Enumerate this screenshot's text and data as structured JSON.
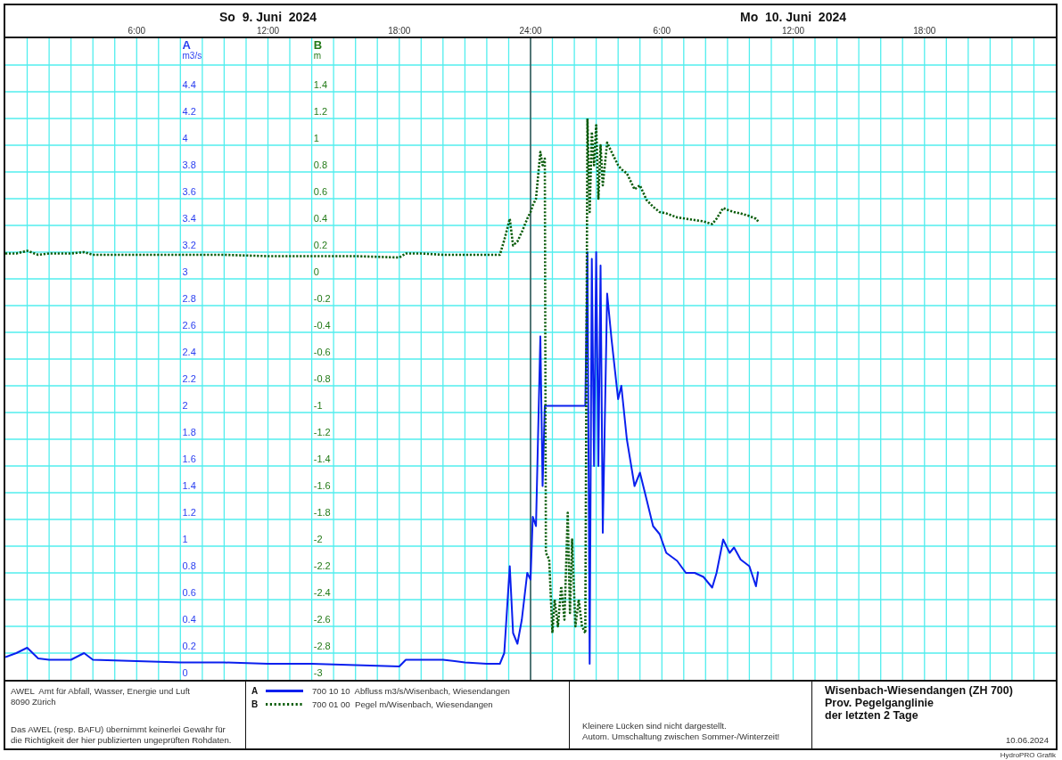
{
  "days": [
    "So  9. Juni  2024",
    "Mo  10. Juni  2024"
  ],
  "charts": [
    {
      "color": "#2a3ff0",
      "chart_data": {
        "type": "line",
        "ylabel": "m3/s",
        "grid": true,
        "xlim": [
          "2024-06-09T00:00",
          "2024-06-11T00:00"
        ],
        "ylim": [
          0,
          4.8
        ],
        "xticks": [
          {
            "value": "2024-06-09T06:00",
            "label": "6:00"
          },
          {
            "value": "2024-06-09T12:00",
            "label": "12:00"
          },
          {
            "value": "2024-06-09T18:00",
            "label": "18:00"
          },
          {
            "value": "2024-06-09T24:00",
            "label": "24:00"
          },
          {
            "value": "2024-06-10T06:00",
            "label": "6:00"
          },
          {
            "value": "2024-06-10T12:00",
            "label": "12:00"
          },
          {
            "value": "2024-06-10T18:00",
            "label": "18:00"
          }
        ],
        "yticks": [
          {
            "value": 0,
            "label": "0"
          },
          {
            "value": 0.2,
            "label": "0.2"
          },
          {
            "value": 0.4,
            "label": "0.4"
          },
          {
            "value": 0.6,
            "label": "0.6"
          },
          {
            "value": 0.8,
            "label": "0.8"
          },
          {
            "value": 1,
            "label": "1"
          },
          {
            "value": 1.2,
            "label": "1.2"
          },
          {
            "value": 1.4,
            "label": "1.4"
          },
          {
            "value": 1.6,
            "label": "1.6"
          },
          {
            "value": 1.8,
            "label": "1.8"
          },
          {
            "value": 2,
            "label": "2"
          },
          {
            "value": 2.2,
            "label": "2.2"
          },
          {
            "value": 2.4,
            "label": "2.4"
          },
          {
            "value": 2.6,
            "label": "2.6"
          },
          {
            "value": 2.8,
            "label": "2.8"
          },
          {
            "value": 3,
            "label": "3"
          },
          {
            "value": 3.2,
            "label": "3.2"
          },
          {
            "value": 3.4,
            "label": "3.4"
          },
          {
            "value": 3.6,
            "label": "3.6"
          },
          {
            "value": 3.8,
            "label": "3.8"
          },
          {
            "value": 4,
            "label": "4"
          },
          {
            "value": 4.2,
            "label": "4.2"
          },
          {
            "value": 4.4,
            "label": "4.4"
          }
        ],
        "ref_lines": [
          {
            "axis": "x",
            "value": "2024-06-09T24:00"
          }
        ],
        "x": [
          "2024-06-09T00:00",
          "2024-06-09T00:30",
          "2024-06-09T01:00",
          "2024-06-09T01:30",
          "2024-06-09T02:00",
          "2024-06-09T03:00",
          "2024-06-09T03:36",
          "2024-06-09T04:00",
          "2024-06-09T06:00",
          "2024-06-09T08:00",
          "2024-06-09T10:00",
          "2024-06-09T12:00",
          "2024-06-09T14:00",
          "2024-06-09T16:00",
          "2024-06-09T18:00",
          "2024-06-09T18:18",
          "2024-06-09T19:00",
          "2024-06-09T20:00",
          "2024-06-09T21:00",
          "2024-06-09T22:00",
          "2024-06-09T22:36",
          "2024-06-09T22:48",
          "2024-06-09T23:03",
          "2024-06-09T23:12",
          "2024-06-09T23:24",
          "2024-06-09T23:36",
          "2024-06-09T23:51",
          "2024-06-10T00:00",
          "2024-06-10T00:06",
          "2024-06-10T00:15",
          "2024-06-10T00:27",
          "2024-06-10T00:33",
          "2024-06-10T00:39",
          "2024-06-10T00:42",
          "2024-06-10T00:51",
          "2024-06-10T01:00",
          "2024-06-10T01:06",
          "2024-06-10T01:15",
          "2024-06-10T01:24",
          "2024-06-10T01:33",
          "2024-06-10T01:42",
          "2024-06-10T01:48",
          "2024-06-10T01:54",
          "2024-06-10T02:03",
          "2024-06-10T02:12",
          "2024-06-10T02:21",
          "2024-06-10T02:30",
          "2024-06-10T02:36",
          "2024-06-10T02:42",
          "2024-06-10T02:48",
          "2024-06-10T02:54",
          "2024-06-10T03:00",
          "2024-06-10T03:06",
          "2024-06-10T03:12",
          "2024-06-10T03:18",
          "2024-06-10T03:30",
          "2024-06-10T03:42",
          "2024-06-10T04:00",
          "2024-06-10T04:09",
          "2024-06-10T04:24",
          "2024-06-10T04:45",
          "2024-06-10T05:00",
          "2024-06-10T05:18",
          "2024-06-10T05:36",
          "2024-06-10T05:54",
          "2024-06-10T06:12",
          "2024-06-10T06:42",
          "2024-06-10T07:06",
          "2024-06-10T07:30",
          "2024-06-10T07:54",
          "2024-06-10T08:18",
          "2024-06-10T08:30",
          "2024-06-10T08:48",
          "2024-06-10T09:06",
          "2024-06-10T09:18",
          "2024-06-10T09:36",
          "2024-06-10T10:00",
          "2024-06-10T10:18",
          "2024-06-10T10:24"
        ],
        "series": [
          {
            "name": "A",
            "color": "#0a20ee",
            "line_style": "solid",
            "values": [
              0.17,
              0.2,
              0.24,
              0.16,
              0.15,
              0.15,
              0.2,
              0.15,
              0.14,
              0.13,
              0.13,
              0.12,
              0.12,
              0.11,
              0.1,
              0.15,
              0.15,
              0.15,
              0.13,
              0.12,
              0.12,
              0.2,
              0.85,
              0.35,
              0.27,
              0.45,
              0.8,
              0.75,
              1.22,
              1.15,
              2.57,
              1.45,
              2.05,
              2.05,
              2.05,
              2.05,
              2.05,
              2.05,
              2.05,
              2.05,
              2.05,
              2.05,
              2.05,
              2.05,
              2.05,
              2.05,
              2.05,
              3.2,
              0.12,
              3.15,
              1.6,
              3.2,
              1.6,
              3.1,
              1.1,
              2.89,
              2.55,
              2.1,
              2.2,
              1.8,
              1.45,
              1.55,
              1.35,
              1.15,
              1.09,
              0.95,
              0.89,
              0.8,
              0.8,
              0.77,
              0.69,
              0.8,
              1.05,
              0.95,
              0.99,
              0.9,
              0.85,
              0.7,
              0.81
            ]
          }
        ]
      }
    },
    {
      "color": "#237a18",
      "chart_data": {
        "type": "line",
        "ylabel": "m",
        "xlim": [
          "2024-06-09T00:00",
          "2024-06-11T00:00"
        ],
        "ylim": [
          -3,
          1.8
        ],
        "yticks": [
          {
            "value": -3,
            "label": "-3"
          },
          {
            "value": -2.8,
            "label": "-2.8"
          },
          {
            "value": -2.6,
            "label": "-2.6"
          },
          {
            "value": -2.4,
            "label": "-2.4"
          },
          {
            "value": -2.2,
            "label": "-2.2"
          },
          {
            "value": -2,
            "label": "-2"
          },
          {
            "value": -1.8,
            "label": "-1.8"
          },
          {
            "value": -1.6,
            "label": "-1.6"
          },
          {
            "value": -1.4,
            "label": "-1.4"
          },
          {
            "value": -1.2,
            "label": "-1.2"
          },
          {
            "value": -1,
            "label": "-1"
          },
          {
            "value": -0.8,
            "label": "-0.8"
          },
          {
            "value": -0.6,
            "label": "-0.6"
          },
          {
            "value": -0.4,
            "label": "-0.4"
          },
          {
            "value": -0.2,
            "label": "-0.2"
          },
          {
            "value": 0,
            "label": "0"
          },
          {
            "value": 0.2,
            "label": "0.2"
          },
          {
            "value": 0.4,
            "label": "0.4"
          },
          {
            "value": 0.6,
            "label": "0.6"
          },
          {
            "value": 0.8,
            "label": "0.8"
          },
          {
            "value": 1,
            "label": "1"
          },
          {
            "value": 1.2,
            "label": "1.2"
          },
          {
            "value": 1.4,
            "label": "1.4"
          }
        ],
        "x": [
          "2024-06-09T00:00",
          "2024-06-09T00:30",
          "2024-06-09T01:00",
          "2024-06-09T01:30",
          "2024-06-09T02:00",
          "2024-06-09T03:00",
          "2024-06-09T03:36",
          "2024-06-09T04:00",
          "2024-06-09T06:00",
          "2024-06-09T08:00",
          "2024-06-09T10:00",
          "2024-06-09T12:00",
          "2024-06-09T14:00",
          "2024-06-09T16:00",
          "2024-06-09T18:00",
          "2024-06-09T18:18",
          "2024-06-09T19:00",
          "2024-06-09T20:00",
          "2024-06-09T21:00",
          "2024-06-09T22:00",
          "2024-06-09T22:36",
          "2024-06-09T22:48",
          "2024-06-09T23:03",
          "2024-06-09T23:12",
          "2024-06-09T23:24",
          "2024-06-09T23:36",
          "2024-06-09T23:51",
          "2024-06-10T00:00",
          "2024-06-10T00:06",
          "2024-06-10T00:15",
          "2024-06-10T00:27",
          "2024-06-10T00:33",
          "2024-06-10T00:39",
          "2024-06-10T00:42",
          "2024-06-10T00:51",
          "2024-06-10T01:00",
          "2024-06-10T01:06",
          "2024-06-10T01:15",
          "2024-06-10T01:24",
          "2024-06-10T01:33",
          "2024-06-10T01:42",
          "2024-06-10T01:48",
          "2024-06-10T01:54",
          "2024-06-10T02:03",
          "2024-06-10T02:12",
          "2024-06-10T02:21",
          "2024-06-10T02:30",
          "2024-06-10T02:36",
          "2024-06-10T02:42",
          "2024-06-10T02:48",
          "2024-06-10T02:54",
          "2024-06-10T03:00",
          "2024-06-10T03:06",
          "2024-06-10T03:12",
          "2024-06-10T03:18",
          "2024-06-10T03:30",
          "2024-06-10T03:42",
          "2024-06-10T04:00",
          "2024-06-10T04:09",
          "2024-06-10T04:24",
          "2024-06-10T04:45",
          "2024-06-10T05:00",
          "2024-06-10T05:18",
          "2024-06-10T05:36",
          "2024-06-10T05:54",
          "2024-06-10T06:12",
          "2024-06-10T06:42",
          "2024-06-10T07:06",
          "2024-06-10T07:30",
          "2024-06-10T07:54",
          "2024-06-10T08:18",
          "2024-06-10T08:30",
          "2024-06-10T08:48",
          "2024-06-10T09:06",
          "2024-06-10T09:18",
          "2024-06-10T09:36",
          "2024-06-10T10:00",
          "2024-06-10T10:18",
          "2024-06-10T10:24"
        ],
        "series": [
          {
            "name": "B",
            "color": "#0b5c0b",
            "line_style": "dotted",
            "values": [
              0.19,
              0.19,
              0.21,
              0.18,
              0.19,
              0.19,
              0.2,
              0.18,
              0.18,
              0.18,
              0.18,
              0.17,
              0.17,
              0.17,
              0.16,
              0.19,
              0.19,
              0.18,
              0.18,
              0.18,
              0.18,
              0.29,
              0.45,
              0.25,
              0.28,
              0.35,
              0.45,
              0.5,
              0.55,
              0.6,
              0.95,
              0.85,
              0.9,
              -2.05,
              -2.1,
              -2.65,
              -2.4,
              -2.6,
              -2.3,
              -2.55,
              -1.75,
              -2.5,
              -1.95,
              -2.6,
              -2.4,
              -2.6,
              -2.65,
              1.2,
              0.5,
              1.1,
              0.85,
              1.15,
              0.6,
              1.0,
              0.7,
              1.02,
              0.95,
              0.85,
              0.82,
              0.79,
              0.67,
              0.7,
              0.59,
              0.54,
              0.5,
              0.49,
              0.46,
              0.45,
              0.44,
              0.43,
              0.41,
              0.45,
              0.53,
              0.51,
              0.5,
              0.49,
              0.47,
              0.45,
              0.43
            ]
          }
        ]
      }
    }
  ],
  "footer": {
    "organization": "AWEL  Amt für Abfall, Wasser, Energie und Luft",
    "address": "8090 Zürich",
    "disclaimer": "Das AWEL (resp. BAFU) übernimmt keinerlei Gewähr für\ndie Richtigkeit der hier publizierten ungeprüften Rohdaten.",
    "legend": [
      {
        "letter": "A",
        "kind": "solid",
        "color": "#0a20ee",
        "text": "700 10 10  Abfluss m3/s/Wisenbach, Wiesendangen"
      },
      {
        "letter": "B",
        "kind": "dotted",
        "color": "#0b5c0b",
        "text": "700 01 00  Pegel m/Wisenbach, Wiesendangen"
      }
    ],
    "notes": [
      "Kleinere Lücken sind nicht dargestellt.",
      "Autom. Umschaltung zwischen Sommer-/Winterzeit!"
    ],
    "title_lines": [
      "Wisenbach-Wiesendangen (ZH 700)",
      "Prov. Pegelganglinie",
      "der letzten 2 Tage"
    ],
    "date": "10.06.2024"
  },
  "credit": "HydroPRO Grafik"
}
